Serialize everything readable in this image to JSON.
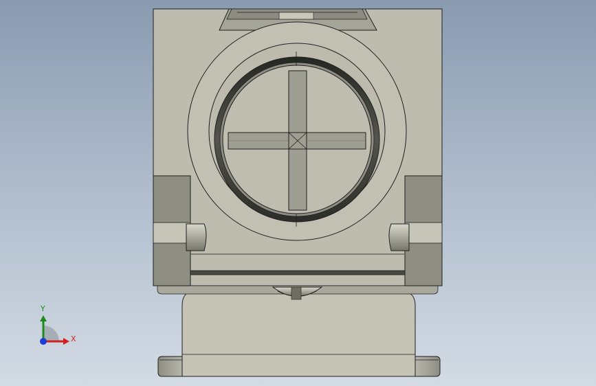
{
  "viewport": {
    "model_colors": {
      "body_face": "#bdbcaf",
      "body_shadow": "#8e8e83",
      "body_dark": "#6e6e65",
      "edge_line": "#1e1e1e",
      "ring_dark": "#3a3a35",
      "background_top": "#8a9bb0",
      "background_bottom": "#d3dbe4"
    }
  },
  "triad": {
    "x_label": "X",
    "y_label": "Y",
    "x_color": "#d21e1e",
    "y_color": "#1c8a1c",
    "z_color": "#1f3bd6"
  }
}
